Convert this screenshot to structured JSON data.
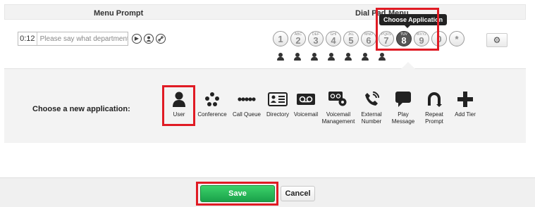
{
  "header": {
    "menu_prompt": "Menu Prompt",
    "dial_pad": "Dial Pad",
    "menu": "Menu"
  },
  "prompt": {
    "time": "0:12",
    "text": "Please say what department"
  },
  "dialpad": {
    "keys": [
      {
        "num": "1",
        "letters": ""
      },
      {
        "num": "2",
        "letters": "ABC"
      },
      {
        "num": "3",
        "letters": "DEF"
      },
      {
        "num": "4",
        "letters": "GHI"
      },
      {
        "num": "5",
        "letters": "JKL"
      },
      {
        "num": "6",
        "letters": "MNO"
      },
      {
        "num": "7",
        "letters": "PQRS"
      },
      {
        "num": "8",
        "letters": "TUV"
      },
      {
        "num": "9",
        "letters": "WXYZ"
      },
      {
        "num": "0",
        "letters": ""
      },
      {
        "num": "*",
        "letters": ""
      }
    ],
    "active_key": "8",
    "tooltip": "Choose Application"
  },
  "panel": {
    "label": "Choose a new application:",
    "apps": [
      {
        "label": "User",
        "icon": "user-icon"
      },
      {
        "label": "Conference",
        "icon": "conference-icon"
      },
      {
        "label": "Call Queue",
        "icon": "call-queue-icon"
      },
      {
        "label": "Directory",
        "icon": "directory-icon"
      },
      {
        "label": "Voicemail",
        "icon": "voicemail-icon"
      },
      {
        "label": "Voicemail Management",
        "icon": "voicemail-management-icon"
      },
      {
        "label": "External Number",
        "icon": "external-number-icon"
      },
      {
        "label": "Play Message",
        "icon": "play-message-icon"
      },
      {
        "label": "Repeat Prompt",
        "icon": "repeat-prompt-icon"
      },
      {
        "label": "Add Tier",
        "icon": "add-tier-icon"
      }
    ],
    "selected": "User"
  },
  "footer": {
    "save": "Save",
    "cancel": "Cancel"
  },
  "colors": {
    "highlight": "#e01b24",
    "save_green": "#1aa14a"
  }
}
